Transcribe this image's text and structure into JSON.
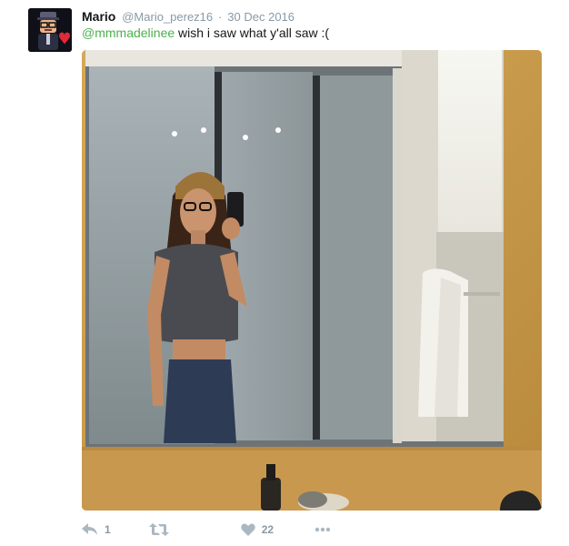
{
  "tweet": {
    "display_name": "Mario",
    "screen_name": "@Mario_perez16",
    "separator": "·",
    "date": "30 Dec 2016",
    "mention": "@mmmadelinee",
    "text": " wish i saw what y'all saw :("
  },
  "actions": {
    "reply_count": "1",
    "retweet_count": "",
    "like_count": "22"
  },
  "icons": {
    "reply": "reply-icon",
    "retweet": "retweet-icon",
    "like": "heart-icon",
    "more": "more-dots-icon"
  },
  "colors": {
    "mention": "#4cb04c",
    "meta_gray": "#8899a6",
    "avatar_heart": "#e02a3a"
  }
}
